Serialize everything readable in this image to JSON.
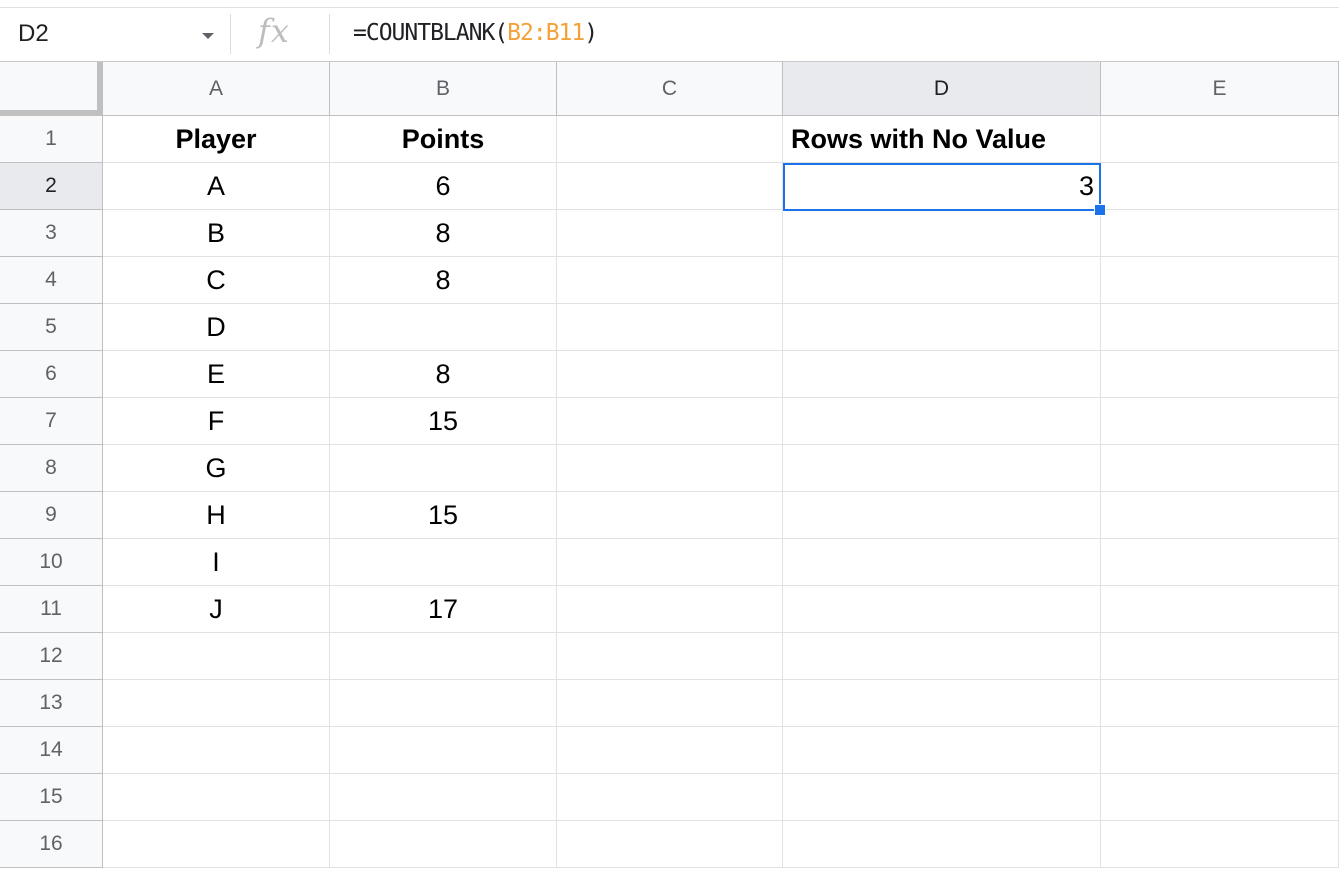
{
  "formula_bar": {
    "name_box": "D2",
    "fx_label": "fx",
    "formula_prefix": "=COUNTBLANK(",
    "formula_ref": "B2:B11",
    "formula_suffix": ")"
  },
  "selected_cell": "D2",
  "columns": [
    "A",
    "B",
    "C",
    "D",
    "E"
  ],
  "rows": [
    "1",
    "2",
    "3",
    "4",
    "5",
    "6",
    "7",
    "8",
    "9",
    "10",
    "11",
    "12",
    "13",
    "14",
    "15",
    "16"
  ],
  "cells": {
    "A1": "Player",
    "B1": "Points",
    "D1": "Rows with No Value",
    "A2": "A",
    "B2": "6",
    "D2": "3",
    "A3": "B",
    "B3": "8",
    "A4": "C",
    "B4": "8",
    "A5": "D",
    "B5": "",
    "A6": "E",
    "B6": "8",
    "A7": "F",
    "B7": "15",
    "A8": "G",
    "B8": "",
    "A9": "H",
    "B9": "15",
    "A10": "I",
    "B10": "",
    "A11": "J",
    "B11": "17"
  },
  "colors": {
    "selection": "#1a73e8",
    "formula_reference": "#f4a13a",
    "header_bg": "#f8f9fa",
    "header_selected_bg": "#e8eaed"
  }
}
